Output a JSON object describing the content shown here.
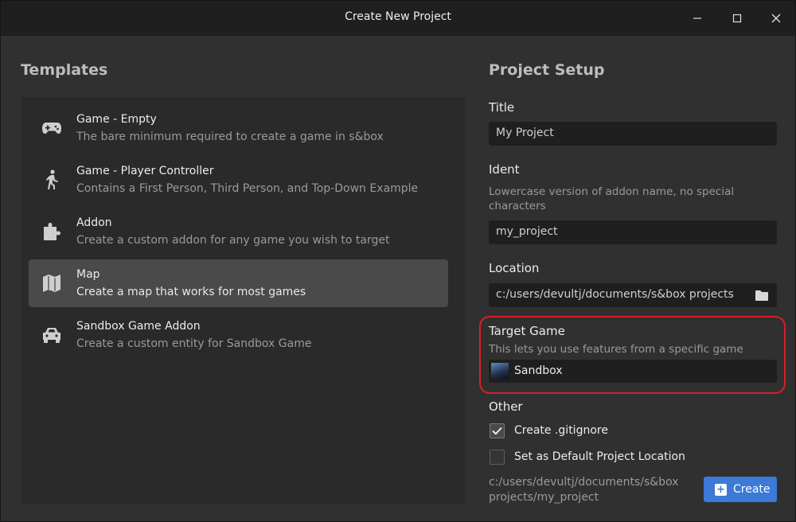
{
  "window": {
    "title": "Create New Project"
  },
  "templates": {
    "heading": "Templates",
    "items": [
      {
        "name": "Game - Empty",
        "description": "The bare minimum required to create a game in s&box",
        "icon": "gamepad-icon",
        "selected": false
      },
      {
        "name": "Game - Player Controller",
        "description": "Contains a First Person, Third Person, and Top-Down Example",
        "icon": "walking-person-icon",
        "selected": false
      },
      {
        "name": "Addon",
        "description": "Create a custom addon for any game you wish to target",
        "icon": "puzzle-icon",
        "selected": false
      },
      {
        "name": "Map",
        "description": "Create a map that works for most games",
        "icon": "map-icon",
        "selected": true
      },
      {
        "name": "Sandbox Game Addon",
        "description": "Create a custom entity for Sandbox Game",
        "icon": "car-icon",
        "selected": false
      }
    ]
  },
  "setup": {
    "heading": "Project Setup",
    "title_label": "Title",
    "title_value": "My Project",
    "ident_label": "Ident",
    "ident_help": "Lowercase version of addon name, no special characters",
    "ident_value": "my_project",
    "location_label": "Location",
    "location_value": "c:/users/devultj/documents/s&box projects",
    "target_label": "Target Game",
    "target_help": "This lets you use features from a specific game",
    "target_value": "Sandbox",
    "other_label": "Other",
    "gitignore_label": "Create .gitignore",
    "gitignore_checked": true,
    "default_location_label": "Set as Default Project Location",
    "default_location_checked": false,
    "path_preview": "c:/users/devultj/documents/s&box projects/my_project",
    "create_label": "Create"
  },
  "colors": {
    "accent": "#3d79d6",
    "highlight": "#d41f24",
    "selected": "#4a4a4a"
  }
}
